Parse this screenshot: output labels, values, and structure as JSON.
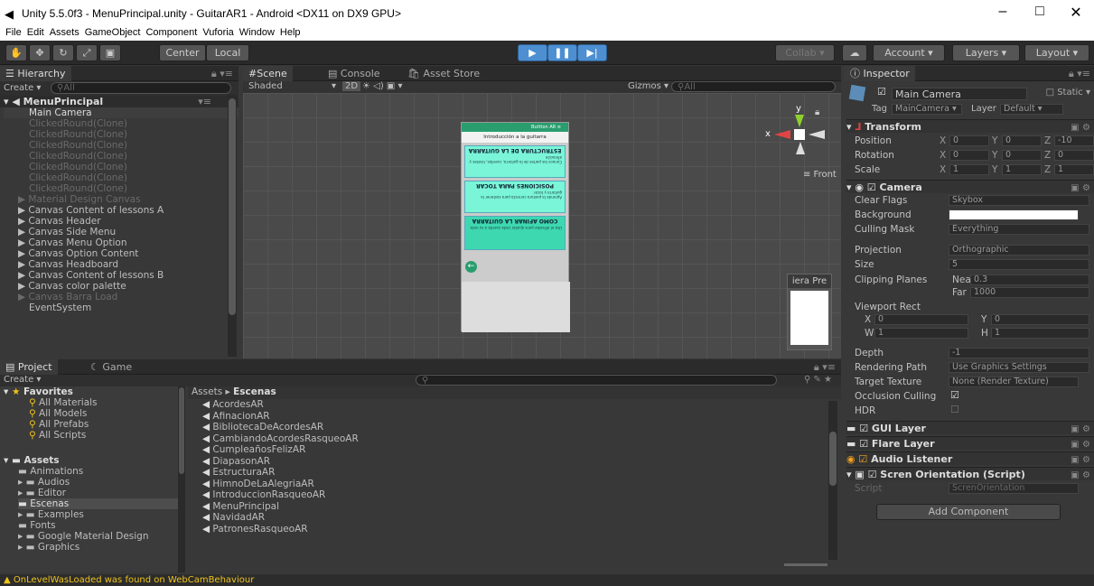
{
  "window": {
    "title": "Unity 5.5.0f3 - MenuPrincipal.unity - GuitarAR1 - Android <DX11 on DX9 GPU>",
    "minimize": "–",
    "maximize": "□",
    "close": "✕"
  },
  "menu": [
    "File",
    "Edit",
    "Assets",
    "GameObject",
    "Component",
    "Vuforia",
    "Window",
    "Help"
  ],
  "toolbar": {
    "center": "Center",
    "local": "Local",
    "collab": "Collab ▾",
    "account": "Account",
    "layers": "Layers",
    "layout": "Layout"
  },
  "hierarchy": {
    "tab": "Hierarchy",
    "create": "Create ▾",
    "search": "All",
    "scene": "MenuPrincipal",
    "items": [
      {
        "label": "Main Camera",
        "state": "sel"
      },
      {
        "label": "ClickedRound(Clone)",
        "state": "dim"
      },
      {
        "label": "ClickedRound(Clone)",
        "state": "dim"
      },
      {
        "label": "ClickedRound(Clone)",
        "state": "dim"
      },
      {
        "label": "ClickedRound(Clone)",
        "state": "dim"
      },
      {
        "label": "ClickedRound(Clone)",
        "state": "dim"
      },
      {
        "label": "ClickedRound(Clone)",
        "state": "dim"
      },
      {
        "label": "ClickedRound(Clone)",
        "state": "dim"
      },
      {
        "label": "▶ Material Design Canvas",
        "state": "dim"
      },
      {
        "label": "▶ Canvas Content  of lessons A",
        "state": "n"
      },
      {
        "label": "▶ Canvas Header",
        "state": "n"
      },
      {
        "label": "▶ Canvas Side Menu",
        "state": "n"
      },
      {
        "label": "▶ Canvas Menu Option",
        "state": "n"
      },
      {
        "label": "▶ Canvas Option Content",
        "state": "n"
      },
      {
        "label": "▶ Canvas Headboard",
        "state": "n"
      },
      {
        "label": "▶ Canvas Content  of lessons B",
        "state": "n"
      },
      {
        "label": "▶ Canvas color palette",
        "state": "n"
      },
      {
        "label": "▶ Canvas Barra Load",
        "state": "dim"
      },
      {
        "label": "EventSystem",
        "state": "n"
      }
    ]
  },
  "scene": {
    "tab_scene": "Scene",
    "tab_console": "Console",
    "tab_store": "Asset Store",
    "shaded": "Shaded",
    "mode2d": "2D",
    "gizmos": "Gizmos ▾",
    "search": "All",
    "front": "≡ Front",
    "y": "y",
    "x": "x",
    "cam_preview": "iera Pre",
    "phone": {
      "header": "Buttton AR",
      "intro": "Introducción a la guitarra",
      "cards": [
        {
          "title": "ESTRUCTURA DE LA GUITARRA",
          "body": "Conoce las partes de la guitarra, cuerdas, trastes y afinación"
        },
        {
          "title": "POSICIONES PARA TOCAR",
          "body": "Aprende la postura correcta para sostener la guitarra y tocar"
        },
        {
          "title": "COMO AFINAR LA GUITARRA",
          "body": "Usa el afinador para ajustar cada cuerda a su nota"
        }
      ]
    }
  },
  "project": {
    "tab_project": "Project",
    "tab_game": "Game",
    "create": "Create ▾",
    "favorites": "Favorites",
    "fav_items": [
      "All Materials",
      "All Models",
      "All Prefabs",
      "All Scripts"
    ],
    "assets": "Assets",
    "folders": [
      "Animations",
      "Audios",
      "Editor",
      "Escenas",
      "Examples",
      "Fonts",
      "Google Material Design",
      "Graphics"
    ],
    "breadcrumb_root": "Assets ▸",
    "breadcrumb_cur": "Escenas",
    "scenes": [
      "AcordesAR",
      "AfinacionAR",
      "BibliotecaDeAcordesAR",
      "CambiandoAcordesRasqueoAR",
      "CumpleañosFelizAR",
      "DiapasonAR",
      "EstructuraAR",
      "HimnoDeLaAlegriaAR",
      "IntroduccionRasqueoAR",
      "MenuPrincipal",
      "NavidadAR",
      "PatronesRasqueoAR"
    ]
  },
  "inspector": {
    "tab": "Inspector",
    "object": "Main Camera",
    "static": "Static",
    "tag_label": "Tag",
    "tag": "MainCamera",
    "layer_label": "Layer",
    "layer": "Default",
    "transform": {
      "title": "Transform",
      "rows": [
        {
          "label": "Position",
          "x": "0",
          "y": "0",
          "z": "-10"
        },
        {
          "label": "Rotation",
          "x": "0",
          "y": "0",
          "z": "0"
        },
        {
          "label": "Scale",
          "x": "1",
          "y": "1",
          "z": "1"
        }
      ]
    },
    "camera": {
      "title": "Camera",
      "clear_flags_label": "Clear Flags",
      "clear_flags": "Skybox",
      "background_label": "Background",
      "culling_label": "Culling Mask",
      "culling": "Everything",
      "projection_label": "Projection",
      "projection": "Orthographic",
      "size_label": "Size",
      "size": "5",
      "clipping_label": "Clipping Planes",
      "near_label": "Near",
      "near": "0.3",
      "far_label": "Far",
      "far": "1000",
      "viewport_label": "Viewport Rect",
      "vx": "0",
      "vy": "0",
      "vw": "1",
      "vh": "1",
      "depth_label": "Depth",
      "depth": "-1",
      "rendering_label": "Rendering Path",
      "rendering": "Use Graphics Settings",
      "target_label": "Target Texture",
      "target": "None (Render Texture)",
      "occlusion_label": "Occlusion Culling",
      "hdr_label": "HDR"
    },
    "components": [
      "GUI Layer",
      "Flare Layer",
      "Audio Listener",
      "Scren Orientation (Script)"
    ],
    "script_label": "Script",
    "script": "ScrenOrientation",
    "add_component": "Add Component"
  },
  "status": {
    "message": "OnLevelWasLoaded was found on WebCamBehaviour"
  }
}
